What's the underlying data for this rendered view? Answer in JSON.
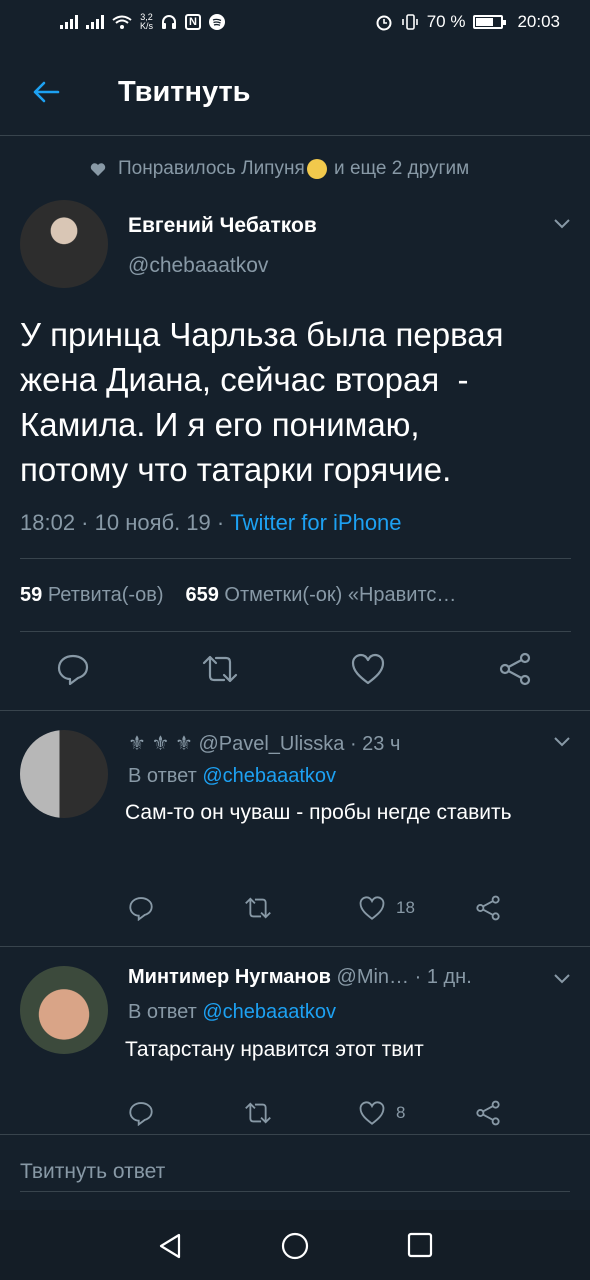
{
  "status_bar": {
    "net_speed_value": "3,2",
    "net_speed_unit": "K/s",
    "nfc": "N",
    "battery_percent": "70 %",
    "time": "20:03"
  },
  "header": {
    "title": "Твитнуть"
  },
  "liked_by": {
    "text_before": "Понравилось Липуня",
    "text_after": "и еще 2 другим"
  },
  "tweet": {
    "author_name": "Евгений Чебатков",
    "author_handle": "@chebaaatkov",
    "text": "У принца Чарльза была первая\nжена Диана, сейчас вторая  -\nКамила. И я его понимаю,\nпотому что татарки горячие.",
    "time": "18:02 · 10 нояб. 19 · ",
    "source": "Twitter for iPhone",
    "retweets_count": "59",
    "retweets_label": "Ретвита(-ов)",
    "likes_count": "659",
    "likes_label": "Отметки(-ок) «Нравитс…"
  },
  "replies": [
    {
      "author_prefix": "⚜ ⚜ ⚜ ",
      "author_handle": "@Pavel_Ulisska",
      "time": " · 23 ч",
      "in_reply_label": "В ответ ",
      "in_reply_to": "@chebaaatkov",
      "text": "Сам-то он чуваш - пробы негде ставить",
      "likes": "18"
    },
    {
      "author_name": "Минтимер Нугманов",
      "author_handle": " @Min…",
      "time": " · 1 дн.",
      "in_reply_label": "В ответ ",
      "in_reply_to": "@chebaaatkov",
      "text": "Татарстану нравится этот твит",
      "likes": "8"
    }
  ],
  "compose": {
    "placeholder": "Твитнуть ответ"
  },
  "colors": {
    "background": "#15202b",
    "accent": "#1da1f2",
    "muted": "#8899a6",
    "divider": "#38444d"
  },
  "icons": [
    "arrow-left-icon",
    "heart-icon",
    "chevron-down-icon",
    "reply-icon",
    "retweet-icon",
    "like-icon",
    "share-icon",
    "nav-back-icon",
    "nav-home-icon",
    "nav-recents-icon"
  ]
}
